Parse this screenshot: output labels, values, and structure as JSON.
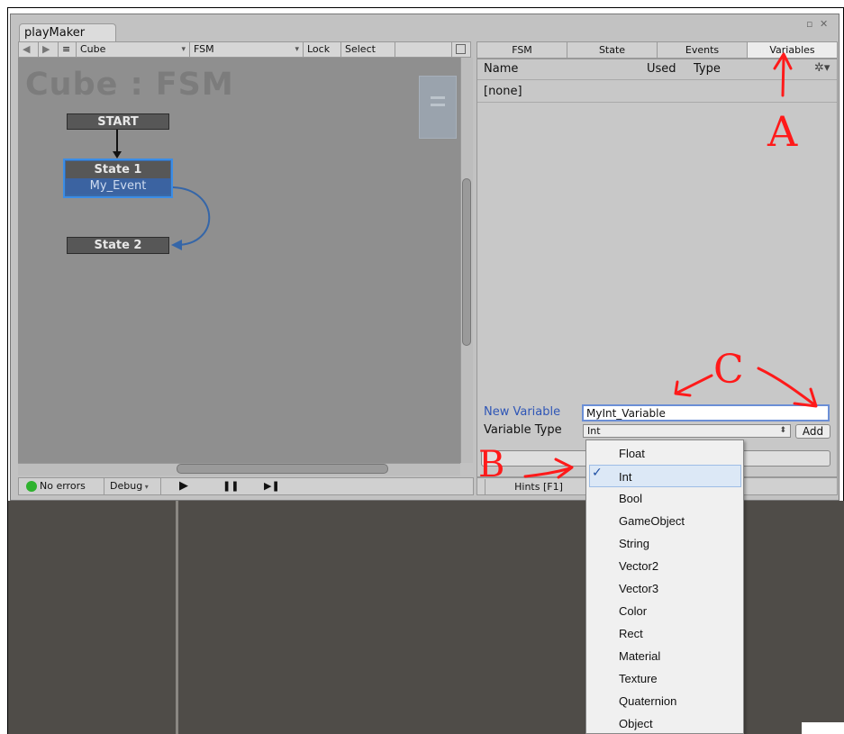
{
  "window": {
    "tab_title": "playMaker",
    "controls": "▫ ✕"
  },
  "toolbar": {
    "nav_back": "◀",
    "nav_forward": "▶",
    "menu": "≡",
    "gameobject": "Cube",
    "fsm": "FSM",
    "lock": "Lock",
    "select": "Select",
    "dropdown_arrow": "▾"
  },
  "canvas": {
    "title": "Cube : FSM",
    "start_node": "START",
    "state1": "State 1",
    "state1_event": "My_Event",
    "state2": "State 2"
  },
  "status_bar": {
    "errors": "No errors",
    "debug": "Debug",
    "play": "▶",
    "pause": "❚❚",
    "step": "▶❚"
  },
  "inspector": {
    "tabs": [
      {
        "label": "FSM"
      },
      {
        "label": "State"
      },
      {
        "label": "Events"
      },
      {
        "label": "Variables",
        "active": true
      }
    ],
    "columns": {
      "name": "Name",
      "used": "Used",
      "type": "Type"
    },
    "empty_row": "[none]",
    "new_variable_label": "New Variable",
    "new_variable_value": "MyInt_Variable",
    "variable_type_label": "Variable Type",
    "variable_type_value": "Int",
    "add_label": "Add",
    "hints_label": "Hints [F1]"
  },
  "type_dropdown": {
    "selected": "Int",
    "options": [
      "Float",
      "Int",
      "Bool",
      "GameObject",
      "String",
      "Vector2",
      "Vector3",
      "Color",
      "Rect",
      "Material",
      "Texture",
      "Quaternion",
      "Object"
    ]
  },
  "annotations": {
    "a": "A",
    "b": "B",
    "c": "C"
  },
  "colors": {
    "accent_blue": "#3b8de6",
    "annotation_red": "#ff1a1a",
    "canvas_bg": "#8f8f8f",
    "status_green": "#2fb22f"
  }
}
